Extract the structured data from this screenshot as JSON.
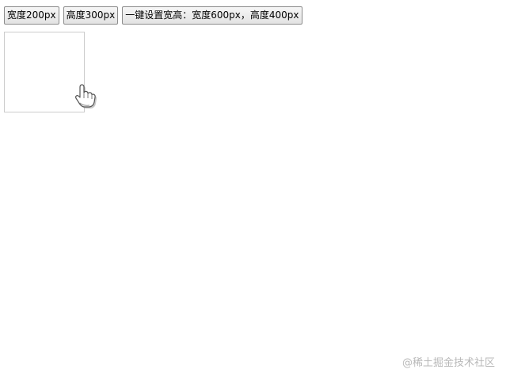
{
  "toolbar": {
    "width_button_label": "宽度200px",
    "height_button_label": "高度300px",
    "both_button_label": "一键设置宽高：宽度600px，高度400px"
  },
  "cursor": {
    "icon": "hand-pointer-icon"
  },
  "watermark": {
    "text": "@稀土掘金技术社区"
  }
}
